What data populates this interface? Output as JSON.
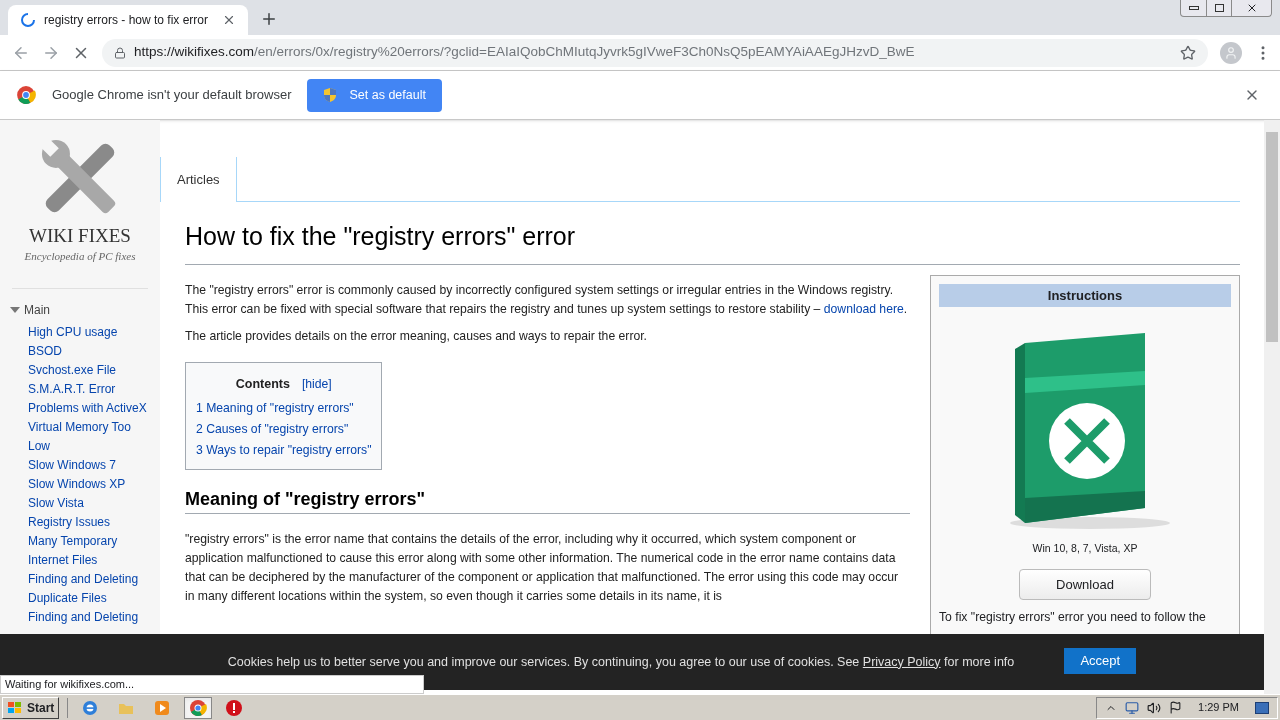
{
  "browser": {
    "tabs": [
      {
        "title": "registry errors - how to fix error",
        "selected": true,
        "loading": true
      }
    ],
    "url": {
      "host": "https://wikifixes.com",
      "path": "/en/errors/0x/registry%20errors/?gclid=EAIaIQobChMIutqJyvrk5gIVweF3Ch0NsQ5pEAMYAiAAEgJHzvD_BwE"
    },
    "infobar": {
      "message": "Google Chrome isn't your default browser",
      "button": "Set as default"
    },
    "status": "Waiting for wikifixes.com..."
  },
  "site": {
    "logo_title": "WIKI FIXES",
    "logo_subtitle": "Encyclopedia of PC fixes",
    "nav_heading": "Main",
    "nav_expanded": true,
    "nav_items": [
      "High CPU usage",
      "BSOD",
      "Svchost.exe File",
      "S.M.A.R.T. Error",
      "Problems with ActiveX",
      "Virtual Memory Too Low",
      "Slow Windows 7",
      "Slow Windows XP",
      "Slow Vista",
      "Registry Issues",
      "Many Temporary Internet Files",
      "Finding and Deleting Duplicate Files",
      "Finding and Deleting"
    ],
    "page_tabs": [
      {
        "label": "Articles",
        "selected": true
      }
    ]
  },
  "article": {
    "title": "How to fix the \"registry errors\" error",
    "intro": "The \"registry errors\" error is commonly caused by incorrectly configured system settings or irregular entries in the Windows registry. This error can be fixed with special software that repairs the registry and tunes up system settings to restore stability –",
    "intro_link": "download here",
    "intro_end": ".",
    "summary": "The article provides details on the error meaning, causes and ways to repair the error.",
    "toc": {
      "title": "Contents",
      "toggle": "[hide]",
      "items": [
        "1 Meaning of \"registry errors\"",
        "2 Causes of \"registry errors\"",
        "3 Ways to repair \"registry errors\""
      ]
    },
    "section_title": "Meaning of \"registry errors\"",
    "section_text": "\"registry errors\" is the error name that contains the details of the error, including why it occurred, which system component or application malfunctioned to cause this error along with some other information. The numerical code in the error name contains data that can be deciphered by the manufacturer of the component or application that malfunctioned. The error using this code may occur in many different locations within the system, so even though it carries some details in its name, it is"
  },
  "instructions": {
    "title": "Instructions",
    "compat": "Win 10, 8, 7, Vista, XP",
    "button": "Download",
    "text": "To fix \"registry errors\" error you need to follow the"
  },
  "cookie_bar": {
    "text": "Cookies help us to better serve you and improve our services. By continuing, you agree to our use of cookies. See",
    "link": "Privacy Policy",
    "text_end": "for more info",
    "button": "Accept"
  },
  "taskbar": {
    "start": "Start",
    "apps": [
      {
        "kind": "ie",
        "active": false
      },
      {
        "kind": "folder",
        "active": false
      },
      {
        "kind": "media",
        "active": false
      },
      {
        "kind": "chrome",
        "active": true
      },
      {
        "kind": "stop",
        "active": false
      }
    ],
    "time": "1:29 PM"
  }
}
